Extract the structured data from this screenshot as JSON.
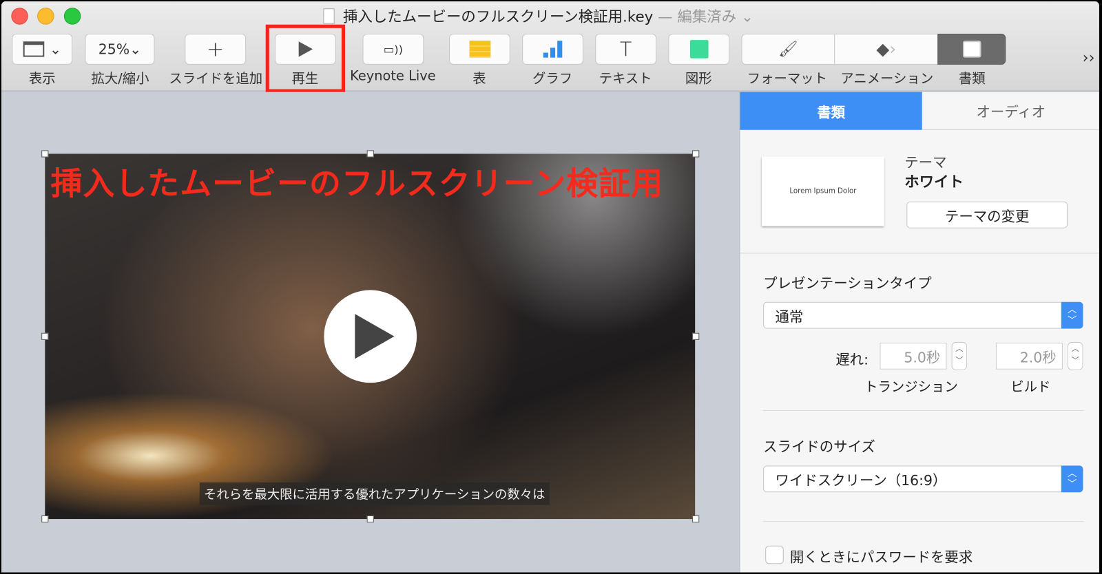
{
  "window": {
    "title": "挿入したムービーのフルスクリーン検証用.key",
    "edited": "— 編集済み"
  },
  "toolbar": {
    "view": {
      "label": "表示"
    },
    "zoom": {
      "label": "拡大/縮小",
      "value": "25%"
    },
    "add_slide": {
      "label": "スライドを追加"
    },
    "play": {
      "label": "再生"
    },
    "keynote_live": {
      "label": "Keynote Live"
    },
    "table": {
      "label": "表"
    },
    "chart": {
      "label": "グラフ"
    },
    "text": {
      "label": "テキスト"
    },
    "shape": {
      "label": "図形"
    },
    "format": {
      "label": "フォーマット"
    },
    "animate": {
      "label": "アニメーション"
    },
    "document": {
      "label": "書類"
    },
    "overflow": "››"
  },
  "slide": {
    "title": "挿入したムービーのフルスクリーン検証用",
    "caption": "それらを最大限に活用する優れたアプリケーションの数々は"
  },
  "panel": {
    "tabs": [
      {
        "label": "書類",
        "active": true
      },
      {
        "label": "オーディオ",
        "active": false
      }
    ],
    "theme": {
      "heading": "テーマ",
      "name": "ホワイト",
      "thumb_text": "Lorem Ipsum Dolor",
      "change_button": "テーマの変更"
    },
    "presentation_type": {
      "heading": "プレゼンテーションタイプ",
      "value": "通常",
      "delay_label": "遅れ:",
      "transition_value": "5.0秒",
      "transition_label": "トランジション",
      "build_value": "2.0秒",
      "build_label": "ビルド"
    },
    "slide_size": {
      "heading": "スライドのサイズ",
      "value": "ワイドスクリーン（16:9）"
    },
    "password": {
      "label": "開くときにパスワードを要求",
      "checked": false
    }
  },
  "colors": {
    "accent": "#3d8ef5",
    "highlight": "#f4231b",
    "slide_title": "#f42a1c"
  }
}
